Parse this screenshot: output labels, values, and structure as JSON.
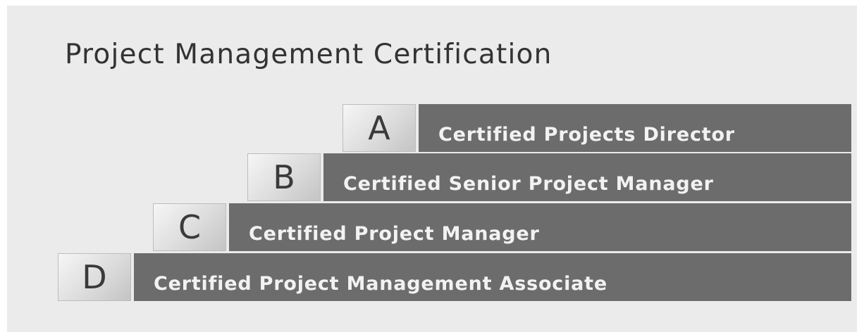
{
  "title": "Project Management Certification",
  "tiers": [
    {
      "letter": "A",
      "label": "Certified Projects Director"
    },
    {
      "letter": "B",
      "label": "Certified Senior Project Manager"
    },
    {
      "letter": "C",
      "label": "Certified Project Manager"
    },
    {
      "letter": "D",
      "label": "Certified Project Management Associate"
    }
  ],
  "colors": {
    "background": "#ebebeb",
    "bar": "#6c6c6c",
    "bar_text": "#f2f2f2",
    "badge_text": "#3a3a3a"
  }
}
